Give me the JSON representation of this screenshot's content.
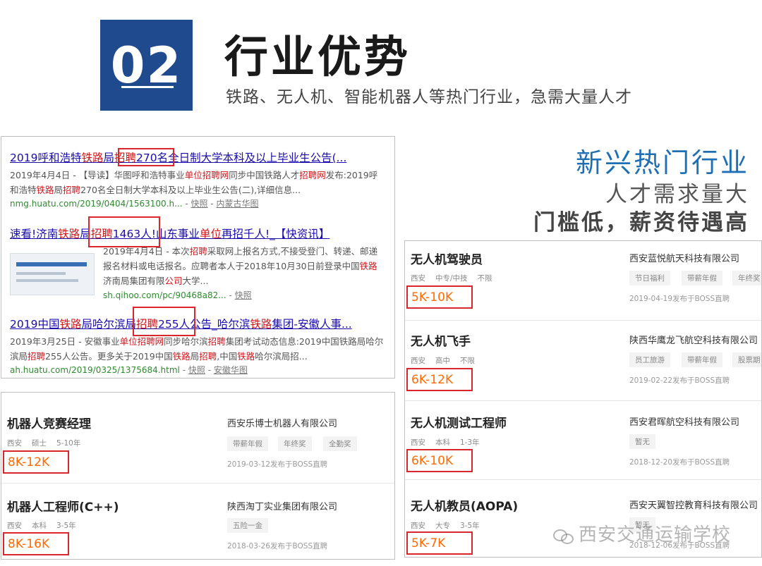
{
  "header": {
    "number": "02",
    "title": "行业优势",
    "subtitle": "铁路、无人机、智能机器人等热门行业，急需大量人才"
  },
  "search_results": [
    {
      "title_parts": [
        "2019呼和浩特",
        "铁路",
        "局",
        "招聘",
        "270名全日制大学本科及以上毕业生公告(..."
      ],
      "desc_l1_parts": [
        "2019年4月4日 - 【导读】华图呼和浩特事业",
        "单位招聘网",
        "同步中国铁路人才",
        "招聘网",
        "发布:2019呼"
      ],
      "desc_l2_parts": [
        "和浩特",
        "铁路",
        "局",
        "招聘",
        "270名全日制大学本科及以上毕业生公告(二),详细信息..."
      ],
      "url": "nmg.huatu.com/2019/0404/1563100.h...",
      "url_links": [
        "快照",
        "内蒙古华图"
      ]
    },
    {
      "title_parts": [
        "速看!济南",
        "铁路",
        "局",
        "招聘",
        "1463人!山东事业",
        "单位",
        "再招千人!_【快资讯】"
      ],
      "desc_l1_parts": [
        "2019年4月4日 - 本次",
        "招聘",
        "采取网上报名方式,不接受登门、转递、邮递"
      ],
      "desc_l2_parts": [
        "报名材料或电话报名。应聘者本人于2018年10月30日前登录中国",
        "铁路"
      ],
      "desc_l3_parts": [
        "济南局集团有限",
        "公司",
        "大学..."
      ],
      "url": "sh.qihoo.com/pc/90468a82...",
      "url_links": [
        "快照"
      ]
    },
    {
      "title_parts": [
        "2019中国",
        "铁路",
        "局哈尔滨局",
        "招聘",
        "255人公告_哈尔滨",
        "铁路",
        "集团-安徽人事..."
      ],
      "desc_l1_parts": [
        "2019年3月25日 - 安徽事业",
        "单位招聘网",
        "同步哈尔滨",
        "招聘",
        "集团考试动态信息:2019中国铁路局哈尔"
      ],
      "desc_l2_parts": [
        "滨局",
        "招聘",
        "255人公告。更多关于2019中国",
        "铁路",
        "局",
        "招聘",
        ",中国",
        "铁路",
        "哈尔滨局招..."
      ],
      "url": "ah.huatu.com/2019/0325/1375684.html",
      "url_links": [
        "快照",
        "安徽华图"
      ]
    }
  ],
  "right_headline": {
    "line1": "新兴热门行业",
    "line2": "人才需求量大",
    "line3": "门槛低，薪资待遇高"
  },
  "left_jobs": [
    {
      "title": "机器人竞赛经理",
      "city": "西安",
      "edu": "硕士",
      "exp": "5-10年",
      "salary": "8K-12K",
      "company": "西安乐博士机器人有限公司",
      "tags": [
        "带薪年假",
        "年终奖",
        "全勤奖"
      ],
      "date": "2019-03-12发布于BOSS直聘"
    },
    {
      "title": "机器人工程师(C++)",
      "city": "西安",
      "edu": "本科",
      "exp": "3-5年",
      "salary": "8K-16K",
      "company": "陕西淘丁实业集团有限公司",
      "tags": [
        "五险一金"
      ],
      "date": "2018-03-26发布于BOSS直聘"
    }
  ],
  "right_jobs": [
    {
      "title": "无人机驾驶员",
      "city": "西安",
      "edu": "中专/中技",
      "exp": "不限",
      "salary": "5K-10K",
      "company": "西安蓝悦航天科技有限公司",
      "tags": [
        "节日福利",
        "带薪年假",
        "年终奖"
      ],
      "date": "2019-04-19发布于BOSS直聘"
    },
    {
      "title": "无人机飞手",
      "city": "西安",
      "edu": "高中",
      "exp": "不限",
      "salary": "6K-12K",
      "company": "陕西华鹰龙飞航空科技有限公司",
      "tags": [
        "员工旅游",
        "带薪年假",
        "股票期"
      ],
      "date": "2019-02-22发布于BOSS直聘"
    },
    {
      "title": "无人机测试工程师",
      "city": "西安",
      "edu": "本科",
      "exp": "1-3年",
      "salary": "6K-10K",
      "company": "西安君晖航空科技有限公司",
      "tags": [
        "暂无"
      ],
      "date": "2018-12-20发布于BOSS直聘"
    },
    {
      "title": "无人机教员(AOPA)",
      "city": "西安",
      "edu": "大专",
      "exp": "3-5年",
      "salary": "5K-7K",
      "company": "西安天翼智控教育科技有限公司",
      "tags": [
        "暂无"
      ],
      "date": "2018-12-06发布于BOSS直聘"
    }
  ],
  "watermark": "西安交通运输学校",
  "colors": {
    "header_box": "#1f4a8d",
    "link_blue": "#1a0dab",
    "keyword_red": "#d0161b",
    "headline_blue": "#1f6fb5",
    "salary_orange": "#ff6a00",
    "highlight_red": "#d9262c",
    "url_green": "#2e8b2e"
  }
}
